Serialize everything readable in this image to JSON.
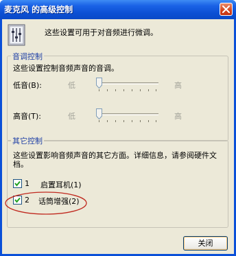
{
  "window": {
    "title": "麦克风 的高级控制",
    "close_icon": "close-icon"
  },
  "intro": {
    "text": "这些设置可用于对音频进行微调。",
    "icon": "mixer-icon"
  },
  "tone_group": {
    "title": "音调控制",
    "description": "这些设置控制音频声音的音调。",
    "bass": {
      "label": "低音(B):",
      "low": "低",
      "high": "高",
      "level": 0.0
    },
    "treble": {
      "label": "高音(T):",
      "low": "低",
      "high": "高",
      "level": 0.0
    }
  },
  "other_group": {
    "title": "其它控制",
    "description_line1": "这些设置影响音频声音的其它方面。详细信息，请参阅硬件文",
    "description_line2": "档。",
    "options": [
      {
        "number": "1",
        "label": "启置耳机(1)",
        "checked": true
      },
      {
        "number": "2",
        "label": "话筒增强(2)",
        "checked": true
      }
    ]
  },
  "buttons": {
    "close_label": "关闭"
  },
  "colors": {
    "titlebar": "#0b4fd3",
    "dialog_bg": "#ece9d8",
    "group_title": "#1e3fa5",
    "annotation": "#c0281e"
  }
}
